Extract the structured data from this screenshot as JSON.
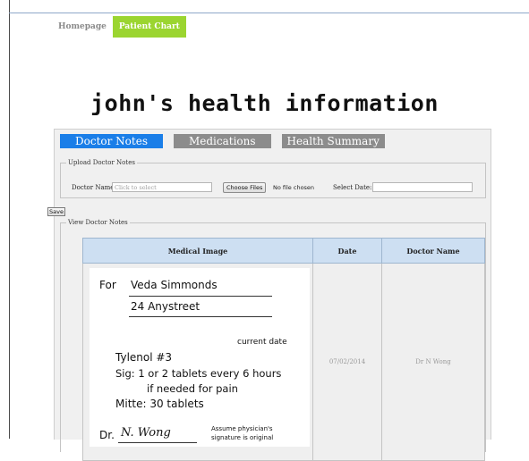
{
  "nav": {
    "homepage": "Homepage",
    "patient_chart": "Patient Chart"
  },
  "title": "john's health information",
  "tabs": {
    "doctor_notes": "Doctor Notes",
    "medications": "Medications",
    "health_summary": "Health Summary"
  },
  "upload": {
    "legend": "Upload Doctor Notes",
    "doctor_name_label": "Doctor Name:",
    "doctor_name_placeholder": "Click to select",
    "choose_files": "Choose Files",
    "no_file": "No file chosen",
    "select_date_label": "Select Date:",
    "select_date_value": ""
  },
  "save_label": "Save",
  "view": {
    "legend": "View Doctor Notes",
    "columns": [
      "Medical Image",
      "Date",
      "Doctor Name"
    ],
    "rows": [
      {
        "date": "07/02/2014",
        "doctor": "Dr N Wong",
        "prescription": {
          "for_label": "For",
          "patient": "Veda Simmonds",
          "address": "24  Anystreet",
          "date_note": "current date",
          "drug": "Tylenol #3",
          "sig1": "Sig: 1 or 2 tablets every 6 hours",
          "sig2": "if needed for pain",
          "mitte": "Mitte: 30 tablets",
          "dr_label": "Dr.",
          "signature": "N. Wong",
          "footnote1": "Assume physician's",
          "footnote2": "signature is original"
        }
      }
    ]
  },
  "colors": {
    "nav_active": "#9bd530",
    "tab_active": "#1a7ee8",
    "tab_inactive": "#8c8c8c",
    "table_header": "#cddff2"
  }
}
